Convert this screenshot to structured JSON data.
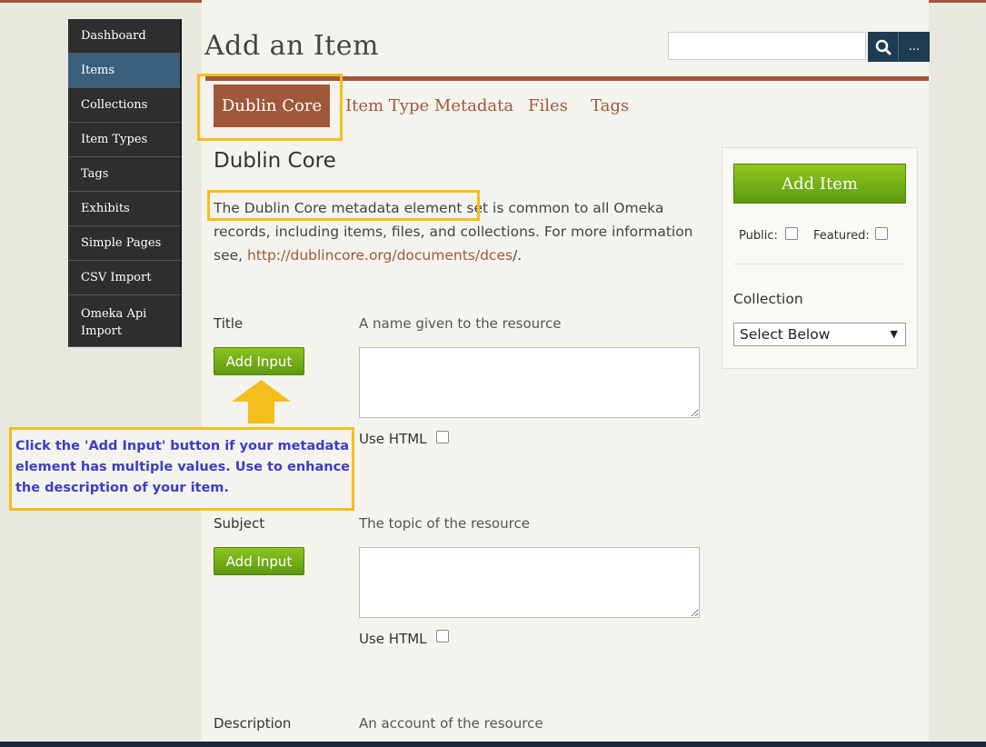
{
  "sidebar": {
    "items": [
      {
        "label": "Dashboard"
      },
      {
        "label": "Items"
      },
      {
        "label": "Collections"
      },
      {
        "label": "Item Types"
      },
      {
        "label": "Tags"
      },
      {
        "label": "Exhibits"
      },
      {
        "label": "Simple Pages"
      },
      {
        "label": "CSV Import"
      },
      {
        "label": "Omeka Api Import"
      }
    ],
    "active": "Items"
  },
  "header": {
    "title": "Add an Item",
    "search_value": "",
    "more_label": "..."
  },
  "tabs": [
    {
      "label": "Dublin Core"
    },
    {
      "label": "Item Type Metadata"
    },
    {
      "label": "Files"
    },
    {
      "label": "Tags"
    }
  ],
  "section": {
    "heading": "Dublin Core",
    "intro_highlighted": "The Dublin Core metadata element set",
    "intro_rest": " is common to all Omeka records, including items, files, and collections. For more information see, ",
    "intro_link": "http://dublincore.org/documents/dces",
    "intro_end": "/."
  },
  "fields": [
    {
      "label": "Title",
      "help": "A name given to the resource",
      "add_input": "Add Input",
      "use_html": "Use HTML"
    },
    {
      "label": "Subject",
      "help": "The topic of the resource",
      "add_input": "Add Input",
      "use_html": "Use HTML"
    },
    {
      "label": "Description",
      "help": "An account of the resource"
    }
  ],
  "panel": {
    "add_item": "Add Item",
    "public_label": "Public:",
    "featured_label": "Featured:",
    "collection_label": "Collection",
    "collection_value": "Select Below"
  },
  "annotation": {
    "callout": "Click the 'Add Input' button if your metadata element has multiple values. Use to enhance the description of your item."
  },
  "colors": {
    "brand": "#a0583b",
    "nav_active": "#3a5f7c",
    "button_green": "#6aa916",
    "highlight": "#f5be1c",
    "callout_text": "#3d3dc4"
  }
}
